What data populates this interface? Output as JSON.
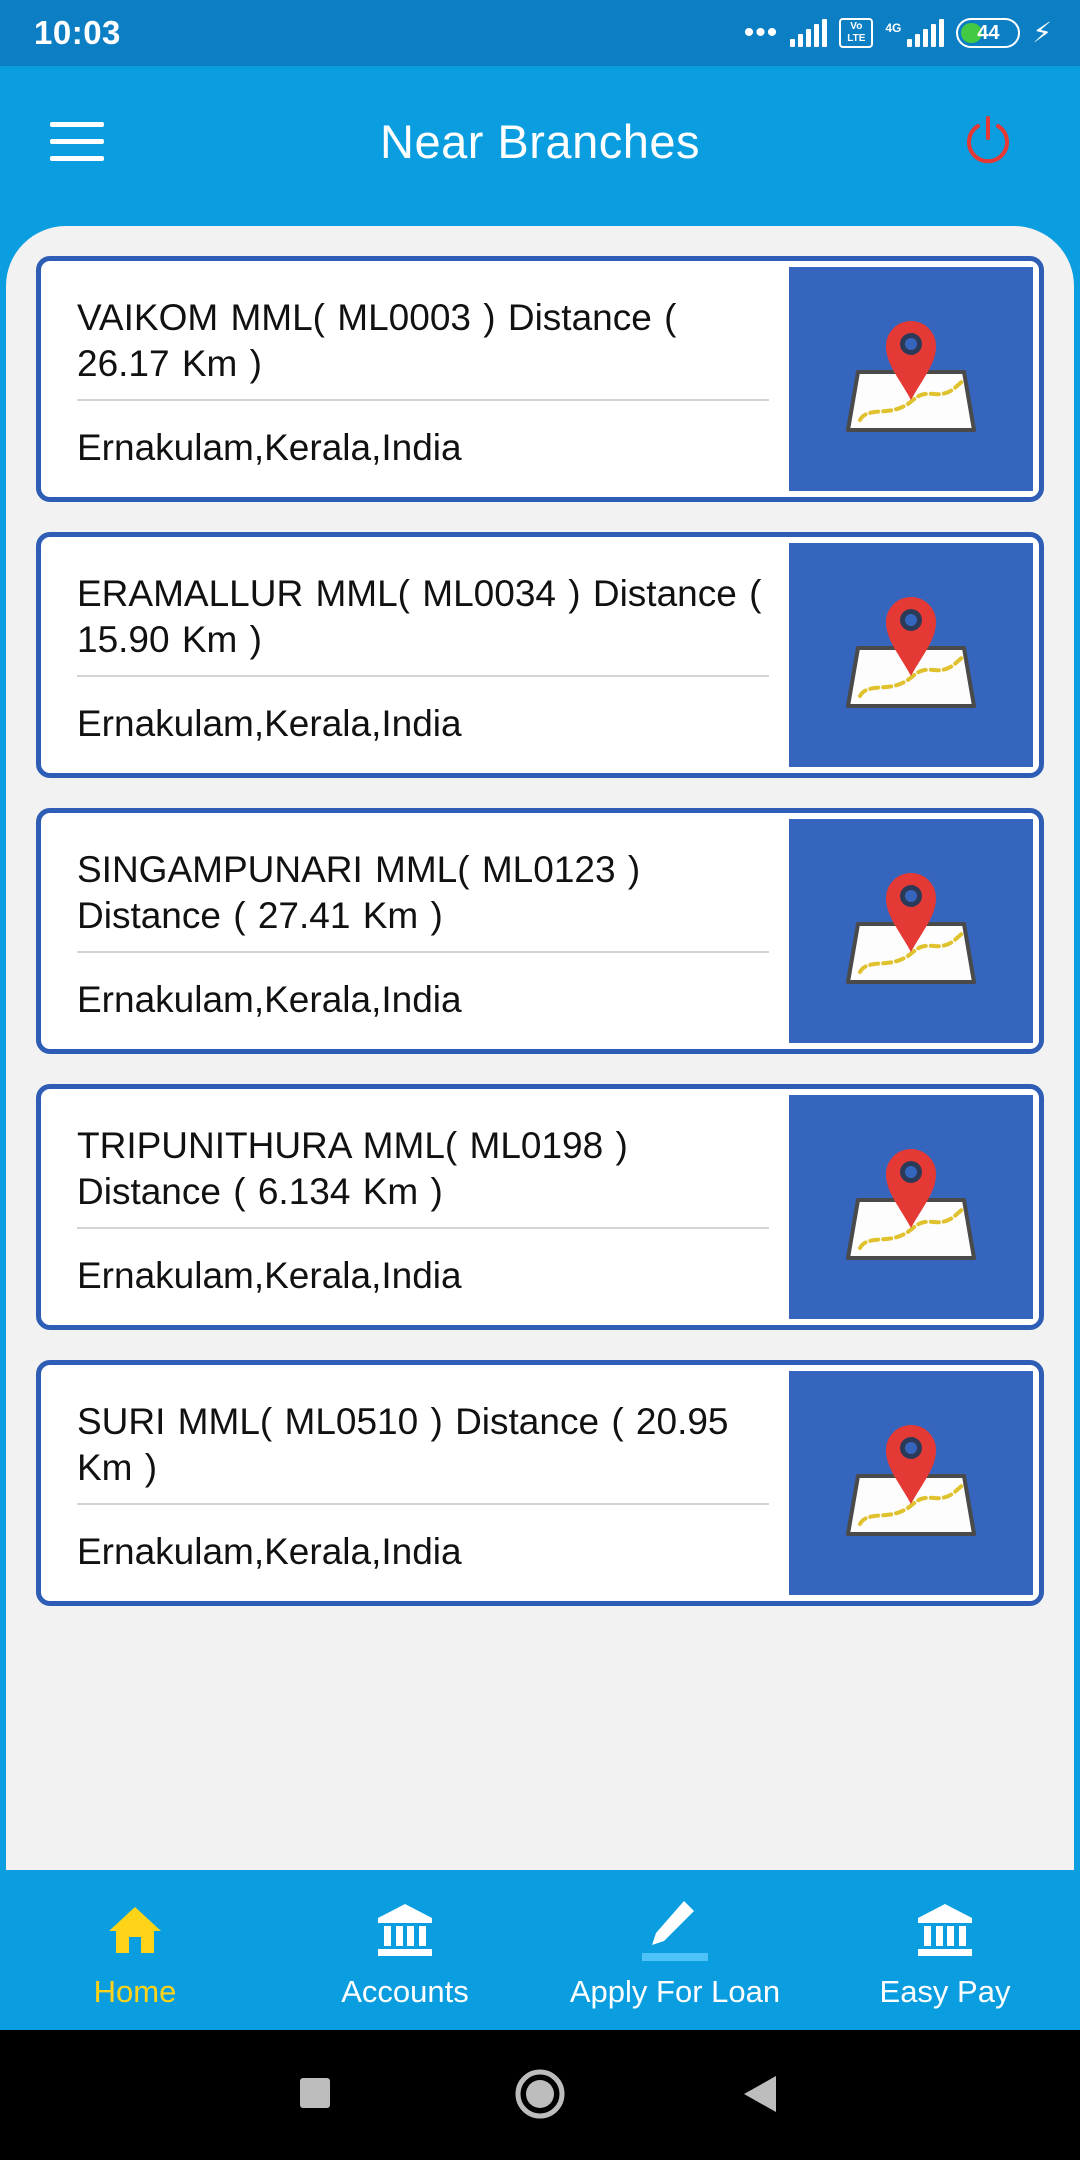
{
  "status_bar": {
    "time": "10:03",
    "dots": "•••",
    "volte": "Vo LTE",
    "network": "4G",
    "battery": "44",
    "battery_level": 0.44
  },
  "header": {
    "title": "Near Branches"
  },
  "branches": [
    {
      "name": "VAIKOM MML( ML0003 )  Distance ( 26.17 Km )",
      "location": "Ernakulam,Kerala,India"
    },
    {
      "name": "ERAMALLUR MML( ML0034 )  Distance ( 15.90 Km )",
      "location": "Ernakulam,Kerala,India"
    },
    {
      "name": "SINGAMPUNARI MML( ML0123 ) Distance ( 27.41 Km )",
      "location": "Ernakulam,Kerala,India"
    },
    {
      "name": "TRIPUNITHURA MML( ML0198 ) Distance ( 6.134 Km )",
      "location": "Ernakulam,Kerala,India"
    },
    {
      "name": "SURI MML( ML0510 )  Distance ( 20.95 Km )",
      "location": "Ernakulam,Kerala,India"
    }
  ],
  "bottom_nav": {
    "items": [
      {
        "label": "Home",
        "icon": "home-icon",
        "active": true
      },
      {
        "label": "Accounts",
        "icon": "bank-icon",
        "active": false
      },
      {
        "label": "Apply For Loan",
        "icon": "pencil-icon",
        "active": false
      },
      {
        "label": "Easy Pay",
        "icon": "bank-icon",
        "active": false
      }
    ]
  },
  "colors": {
    "primary": "#0a9ee0",
    "status_bar": "#0c7fc4",
    "card_border": "#2e5db5",
    "map_tile": "#3565bd",
    "active_tab": "#ffd318",
    "power_icon": "#e53935"
  }
}
